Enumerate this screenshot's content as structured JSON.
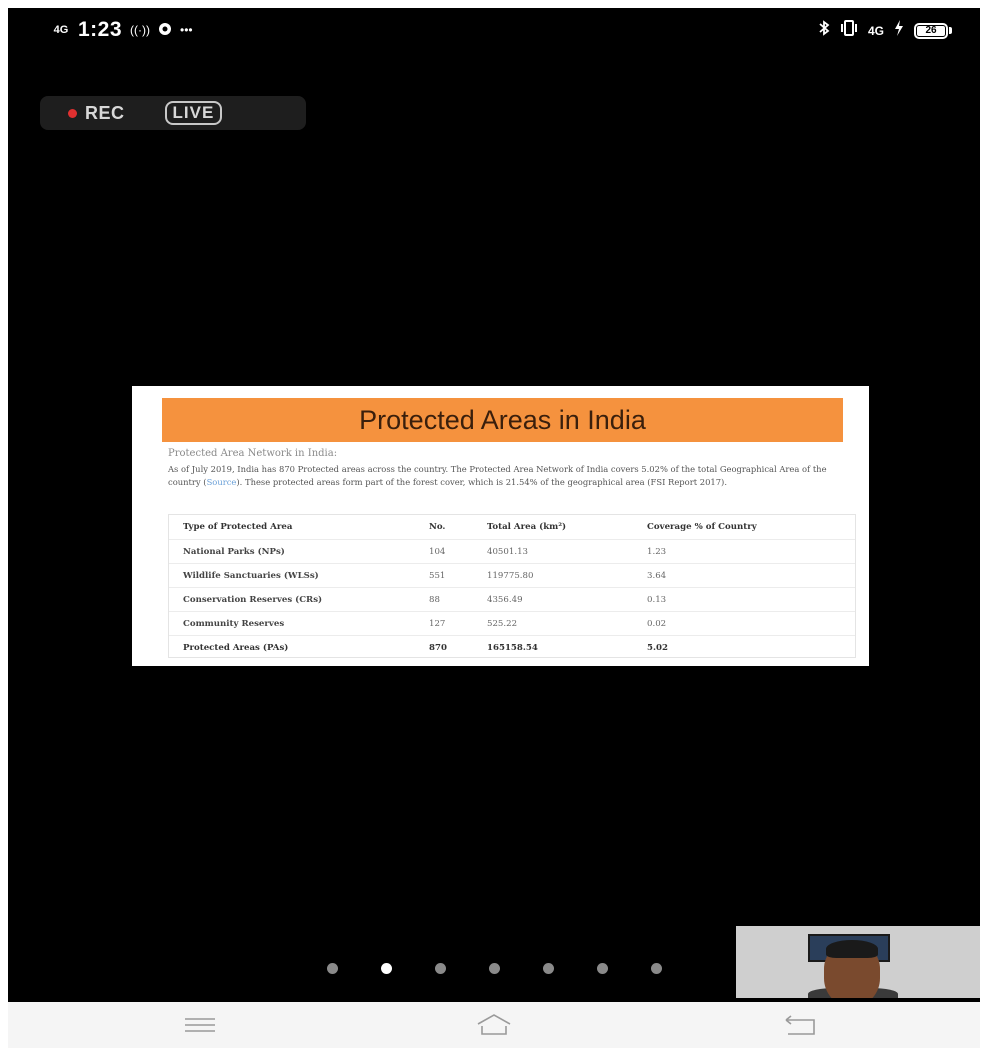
{
  "status_bar": {
    "signal": "4G",
    "time": "1:23",
    "left_extra": "•••",
    "right_icons": [
      "bluetooth-icon",
      "vibrate-icon",
      "signal-4g-icon",
      "charging-icon"
    ],
    "right_text": "4G",
    "battery": "26"
  },
  "recording": {
    "rec_label": "REC",
    "live_label": "LIVE"
  },
  "slide": {
    "title": "Protected Areas in India",
    "subtitle": "Protected Area Network in India:",
    "paragraph_before_link": "As of July 2019, India has 870 Protected areas across the country. The Protected Area Network of India covers 5.02% of the total Geographical Area of the country (",
    "link_text": "Source",
    "paragraph_after_link": "). These protected areas form part of the forest cover, which is 21.54% of the geographical area (FSI Report 2017).",
    "table": {
      "headers": [
        "Type of Protected Area",
        "No.",
        "Total Area (km²)",
        "Coverage % of Country"
      ],
      "rows": [
        [
          "National Parks (NPs)",
          "104",
          "40501.13",
          "1.23"
        ],
        [
          "Wildlife Sanctuaries (WLSs)",
          "551",
          "119775.80",
          "3.64"
        ],
        [
          "Conservation Reserves (CRs)",
          "88",
          "4356.49",
          "0.13"
        ],
        [
          "Community Reserves",
          "127",
          "525.22",
          "0.02"
        ],
        [
          "Protected Areas (PAs)",
          "870",
          "165158.54",
          "5.02"
        ]
      ]
    },
    "colors": {
      "title_bg": "#f5923e",
      "title_text": "#3a1f0c"
    }
  },
  "pagination": {
    "total": 7,
    "active_index": 1
  },
  "camera_preview": {
    "icon": "participant-video-icon"
  },
  "nav_bar": {
    "icons": [
      "menu-icon",
      "home-icon",
      "back-icon"
    ]
  }
}
